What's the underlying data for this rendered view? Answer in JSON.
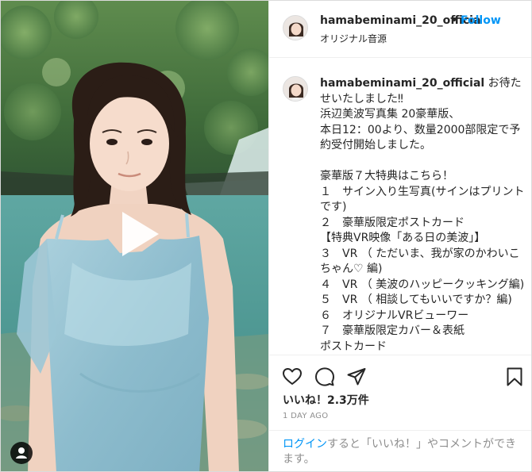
{
  "header": {
    "username": "hamabeminami_20_officia",
    "dot": "•",
    "follow_label": "Follow",
    "audio": "オリジナル音源"
  },
  "caption": {
    "username": "hamabeminami_20_official",
    "text": "お待たせいたしました‼\n浜辺美波写真集 20豪華版、\n本日12：00より、数量2000部限定で予約受付開始しました。\n\n豪華版７大特典はこちら！\n１　サイン入り生写真(サインはプリントです)\n２　豪華版限定ポストカード\n【特典VR映像「ある日の美波」】\n３　VR （ ただいま、我が家のかわいこちゃん♡ 編)\n４　VR （ 美波のハッピークッキング編)\n５　VR （ 相談してもいいですか？編)\n６　オリジナルVRビューワー\n７　豪華版限定カバー＆表紙\nポストカード"
  },
  "actions": {
    "like_icon": "heart-icon",
    "comment_icon": "comment-icon",
    "share_icon": "share-icon",
    "save_icon": "bookmark-icon",
    "likes_text": "いいね！2.3万件",
    "time_ago": "1 DAY AGO",
    "login_link": "ログイン",
    "login_rest": "すると「いいね！」やコメントができます。"
  },
  "media": {
    "play_icon": "play-icon",
    "tag_icon": "user-tag-icon"
  }
}
